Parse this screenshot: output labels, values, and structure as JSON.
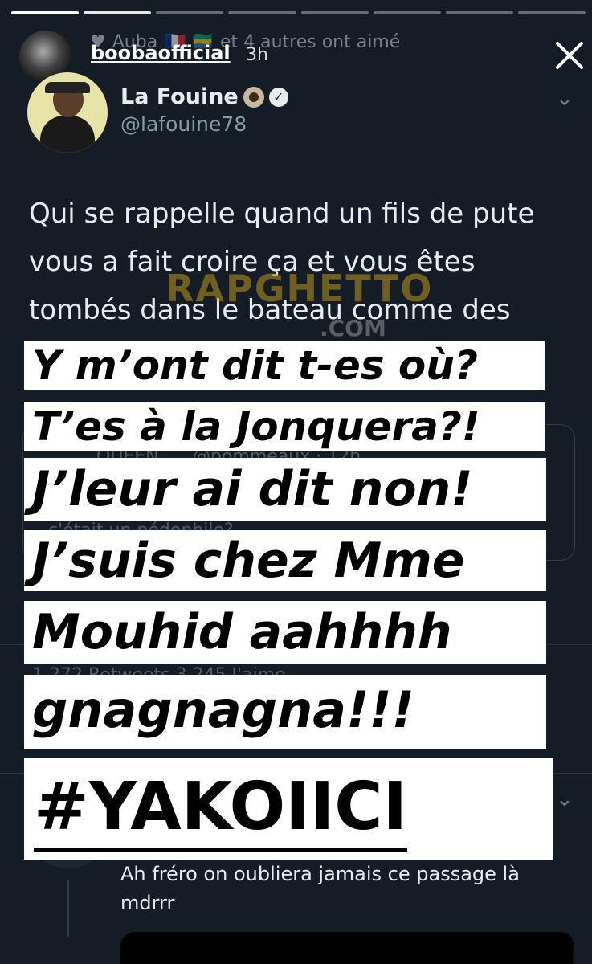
{
  "story": {
    "username": "boobaofficial",
    "time": "3h",
    "progress_segments": 8,
    "progress_active_index": 1
  },
  "liked_by": {
    "name": "Auba",
    "flags": "🇫🇷 🇬🇦",
    "others": "et 4 autres ont aimé"
  },
  "tweet": {
    "name": "La Fouine",
    "handle": "@lafouine78",
    "text": "Qui se rappelle quand un fils de pute vous a fait croire ça et vous êtes tombés dans le bateau comme des"
  },
  "watermark": {
    "main": "RAPGHETTO",
    "sub": ".COM"
  },
  "background_faint": {
    "quote_user": "QUEEN",
    "quote_handle": "@pommeaux · 12h",
    "quote_text": "c'était un pédophile?",
    "stats": "1 272 Retweets  3 245 J'aime"
  },
  "captions": [
    "Y m’ont dit t-es où?",
    "T’es à la Jonquera?!",
    "J’leur ai dit non!",
    "J’suis chez Mme",
    "Mouhid aahhhh",
    "gnagnagna!!!",
    "#YAKOIICI"
  ],
  "reply": {
    "text": "Ah fréro on oubliera jamais ce passage là mdrrr"
  },
  "colors": {
    "background": "#141d26",
    "text": "#e6ecf0",
    "secondary": "#8899a6",
    "caption_bg": "#ffffff",
    "caption_text": "#000000"
  }
}
